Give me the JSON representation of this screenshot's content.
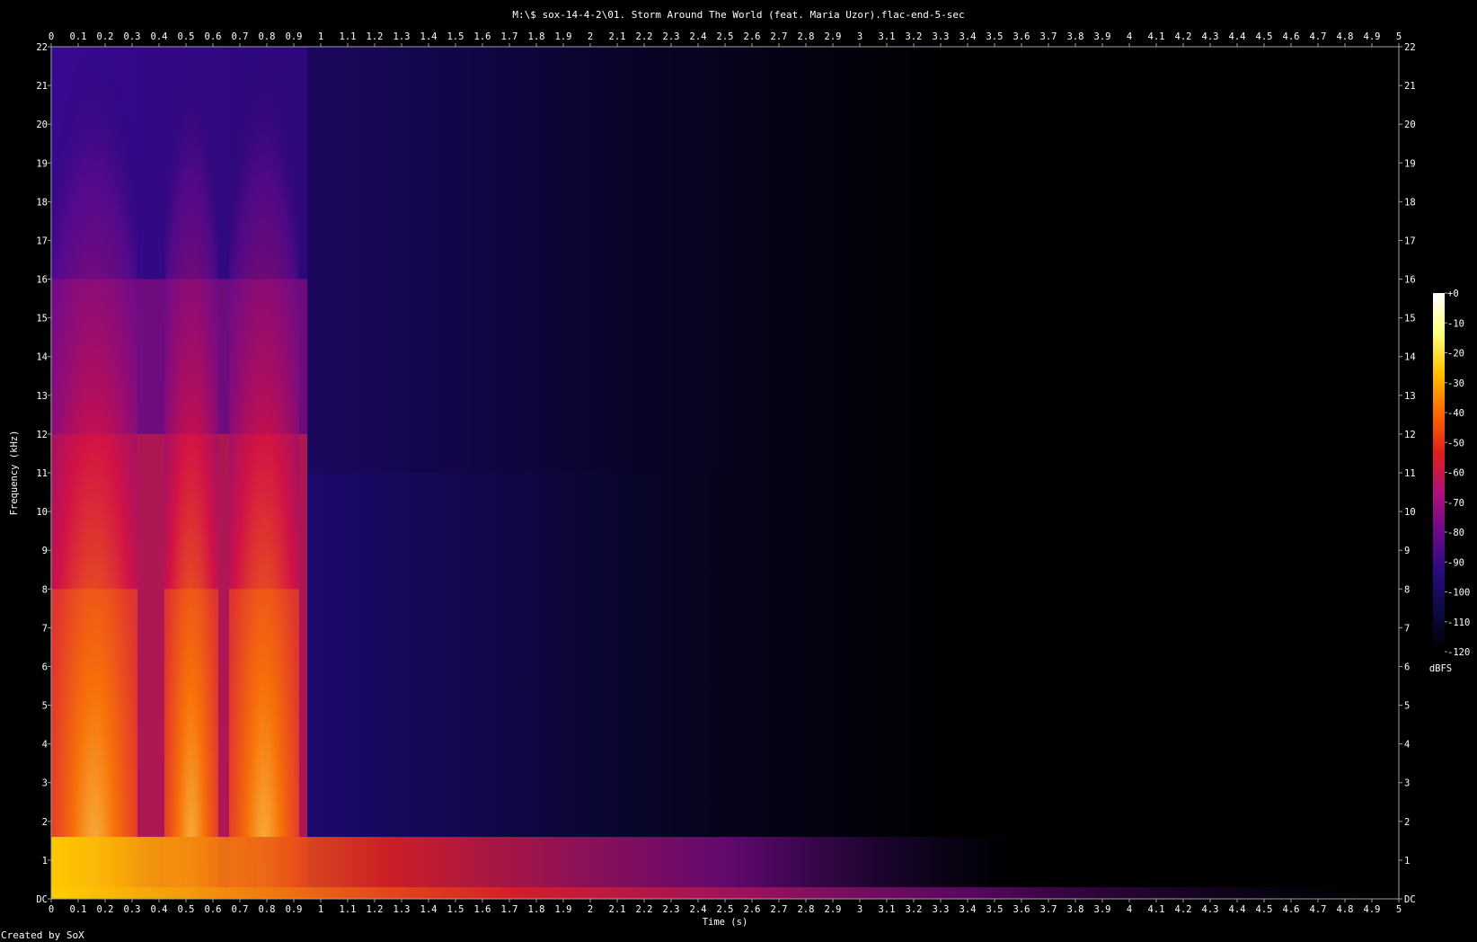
{
  "title": "M:\\$ sox-14-4-2\\01. Storm Around The World (feat. Maria Uzor).flac-end-5-sec",
  "footer": "Created by SoX",
  "chart_data": {
    "type": "heatmap",
    "title": "M:\\$ sox-14-4-2\\01. Storm Around The World (feat. Maria Uzor).flac-end-5-sec",
    "xlabel": "Time (s)",
    "ylabel": "Frequency (kHz)",
    "xlim": [
      0,
      5
    ],
    "ylim": [
      0,
      22
    ],
    "x_ticks": [
      "0",
      "0.1",
      "0.2",
      "0.3",
      "0.4",
      "0.5",
      "0.6",
      "0.7",
      "0.8",
      "0.9",
      "1",
      "1.1",
      "1.2",
      "1.3",
      "1.4",
      "1.5",
      "1.6",
      "1.7",
      "1.8",
      "1.9",
      "2",
      "2.1",
      "2.2",
      "2.3",
      "2.4",
      "2.5",
      "2.6",
      "2.7",
      "2.8",
      "2.9",
      "3",
      "3.1",
      "3.2",
      "3.3",
      "3.4",
      "3.5",
      "3.6",
      "3.7",
      "3.8",
      "3.9",
      "4",
      "4.1",
      "4.2",
      "4.3",
      "4.4",
      "4.5",
      "4.6",
      "4.7",
      "4.8",
      "4.9",
      "5"
    ],
    "y_ticks": [
      "DC",
      "1",
      "2",
      "3",
      "4",
      "5",
      "6",
      "7",
      "8",
      "9",
      "10",
      "11",
      "12",
      "13",
      "14",
      "15",
      "16",
      "17",
      "18",
      "19",
      "20",
      "21",
      "22"
    ],
    "colorbar": {
      "label": "dBFS",
      "range": [
        -120,
        0
      ],
      "ticks": [
        "+0",
        "-10",
        "-20",
        "-30",
        "-40",
        "-50",
        "-60",
        "-70",
        "-80",
        "-90",
        "-100",
        "-110",
        "-120"
      ]
    },
    "colors": [
      "#000000",
      "#0a0a40",
      "#2a0a80",
      "#6a0a8a",
      "#b0107a",
      "#e0201a",
      "#ff6a00",
      "#ffc000",
      "#ffff80",
      "#ffffff"
    ],
    "grid": false
  }
}
